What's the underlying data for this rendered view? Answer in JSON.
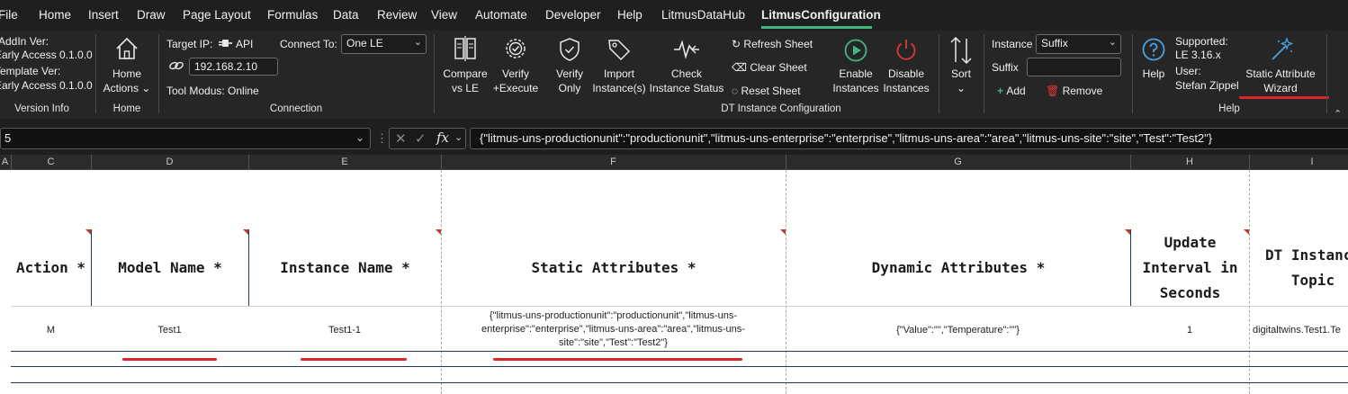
{
  "menu": {
    "items": [
      "File",
      "Home",
      "Insert",
      "Draw",
      "Page Layout",
      "Formulas",
      "Data",
      "Review",
      "View",
      "Automate",
      "Developer",
      "Help",
      "LitmusDataHub",
      "LitmusConfiguration"
    ],
    "active": "LitmusConfiguration"
  },
  "ribbon": {
    "version_info": {
      "addin_label": "AddIn Ver:",
      "addin_value": "Early Access 0.1.0.0",
      "template_label": "Template Ver:",
      "template_value": "Early Access 0.1.0.0",
      "group": "Version Info"
    },
    "home": {
      "label_line1": "Home",
      "label_line2": "Actions ⌄",
      "group": "Home"
    },
    "connection": {
      "target_ip_label": "Target IP:",
      "api_label": "API",
      "ip_value": "192.168.2.10",
      "connect_to_label": "Connect To:",
      "connect_to_value": "One LE",
      "tool_modus": "Tool Modus: Online",
      "group": "Connection"
    },
    "dt_instance": {
      "compare_line1": "Compare",
      "compare_line2": "vs LE",
      "verify_exec_line1": "Verify",
      "verify_exec_line2": "+Execute",
      "verify_only_line1": "Verify",
      "verify_only_line2": "Only",
      "import_line1": "Import",
      "import_line2": "Instance(s)",
      "check_line1": "Check",
      "check_line2": "Instance Status",
      "refresh": "Refresh Sheet",
      "clear": "Clear Sheet",
      "reset": "Reset Sheet",
      "enable_line1": "Enable",
      "enable_line2": "Instances",
      "disable_line1": "Disable",
      "disable_line2": "Instances",
      "sort_line1": "Sort",
      "sort_line2": "⌄",
      "instance_label": "Instance",
      "instance_value": "Suffix",
      "suffix_label": "Suffix",
      "suffix_value": "",
      "add": "Add",
      "remove": "Remove",
      "group": "DT Instance Configuration"
    },
    "help": {
      "help_label": "Help",
      "supported_label": "Supported:",
      "supported_value": "LE 3.16.x",
      "user_label": "User:",
      "user_value": "Stefan Zippel",
      "wizard_line1": "Static Attribute",
      "wizard_line2": "Wizard",
      "group": "Help"
    }
  },
  "formula_bar": {
    "name_box": "5",
    "formula": "{\"litmus-uns-productionunit\":\"productionunit\",\"litmus-uns-enterprise\":\"enterprise\",\"litmus-uns-area\":\"area\",\"litmus-uns-site\":\"site\",\"Test\":\"Test2\"}"
  },
  "columns": [
    "A",
    "C",
    "D",
    "E",
    "F",
    "G",
    "H",
    "I"
  ],
  "table": {
    "headers": {
      "action": "Action *",
      "model": "Model Name *",
      "instance": "Instance Name *",
      "static": "Static Attributes *",
      "dynamic": "Dynamic Attributes *",
      "update_l1": "Update",
      "update_l2": "Interval in",
      "update_l3": "Seconds",
      "topic_l1": "DT Instance",
      "topic_l2": "Topic"
    },
    "row1": {
      "action": "M",
      "model": "Test1",
      "instance": "Test1-1",
      "static_l1": "{\"litmus-uns-productionunit\":\"productionunit\",\"litmus-uns-",
      "static_l2": "enterprise\":\"enterprise\",\"litmus-uns-area\":\"area\",\"litmus-uns-",
      "static_l3": "site\":\"site\",\"Test\":\"Test2\"}",
      "dynamic": "{\"Value\":\"\",\"Temperature\":\"\"}",
      "update": "1",
      "topic": "digitaltwins.Test1.Te"
    }
  },
  "colors": {
    "accent_green": "#43b581",
    "annotation_red": "#d9262a",
    "ribbon_bg": "#262626",
    "menu_bg": "#1f1f1f",
    "table_border": "#1f3a5f"
  }
}
